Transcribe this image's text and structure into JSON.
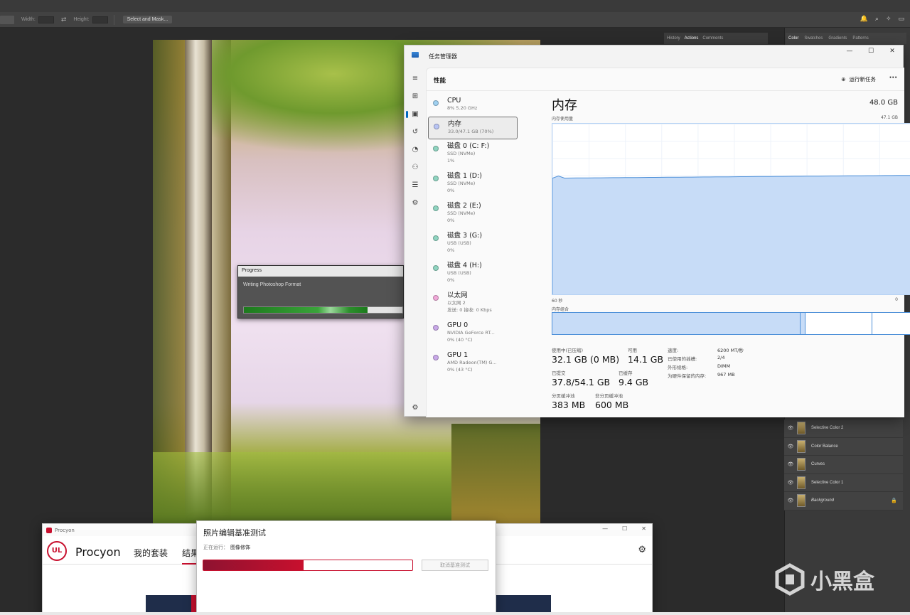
{
  "photoshop": {
    "options_bar": {
      "width_label": "Width:",
      "height_label": "Height:",
      "swap_icon": "swap-icon",
      "select_mask_label": "Select and Mask..."
    },
    "mini_tabs": [
      "History",
      "Actions",
      "Comments"
    ],
    "color_tabs": [
      "Color",
      "Swatches",
      "Gradients",
      "Patterns"
    ],
    "layers": [
      {
        "name": "Selective Color 2"
      },
      {
        "name": "Color Balance"
      },
      {
        "name": "Curves"
      },
      {
        "name": "Selective Color 1"
      },
      {
        "name": "Background"
      }
    ],
    "progress_dialog": {
      "title": "Progress",
      "message": "Writing Photoshop Format",
      "progress_pct": 78
    }
  },
  "task_manager": {
    "title": "任务管理器",
    "window_controls": {
      "minimize": "—",
      "maximize": "☐",
      "close": "✕"
    },
    "section": "性能",
    "run_task": "运行新任务",
    "more": "···",
    "devices": [
      {
        "name": "CPU",
        "sub1": "8% 5.20 GHz",
        "sub2": "",
        "color": "#9fd0f0"
      },
      {
        "name": "内存",
        "sub1": "33.0/47.1 GB (70%)",
        "sub2": "",
        "color": "#b8c4f4"
      },
      {
        "name": "磁盘 0 (C: F:)",
        "sub1": "SSD (NVMe)",
        "sub2": "1%",
        "color": "#8fd4c0"
      },
      {
        "name": "磁盘 1 (D:)",
        "sub1": "SSD (NVMe)",
        "sub2": "0%",
        "color": "#8fd4c0"
      },
      {
        "name": "磁盘 2 (E:)",
        "sub1": "SSD (NVMe)",
        "sub2": "0%",
        "color": "#8fd4c0"
      },
      {
        "name": "磁盘 3 (G:)",
        "sub1": "USB (USB)",
        "sub2": "0%",
        "color": "#8fd4c0"
      },
      {
        "name": "磁盘 4 (H:)",
        "sub1": "USB (USB)",
        "sub2": "0%",
        "color": "#8fd4c0"
      },
      {
        "name": "以太网",
        "sub1": "以太网 2",
        "sub2": "发送: 0 接收: 0 Kbps",
        "color": "#f0a8d8"
      },
      {
        "name": "GPU 0",
        "sub1": "NVIDIA GeForce RT...",
        "sub2": "0% (40 °C)",
        "color": "#c8a8e8"
      },
      {
        "name": "GPU 1",
        "sub1": "AMD Radeon(TM) G...",
        "sub2": "0% (43 °C)",
        "color": "#c8a8e8"
      }
    ],
    "memory": {
      "title": "内存",
      "total": "48.0 GB",
      "usage_label": "内存使用量",
      "usage_max": "47.1 GB",
      "time_left": "60 秒",
      "time_right": "0",
      "composition_label": "内存组合",
      "usage_fraction": 0.7,
      "composition_fractions": [
        0.685,
        0.015,
        0.185,
        0.115
      ],
      "stats": [
        {
          "label": "使用中(已压缩)",
          "value": "32.1 GB (0 MB)"
        },
        {
          "label": "可用",
          "value": "14.1 GB"
        },
        {
          "label": "已提交",
          "value": "37.8/54.1 GB"
        },
        {
          "label": "已缓存",
          "value": "9.4 GB"
        },
        {
          "label": "分页缓冲池",
          "value": "383 MB"
        },
        {
          "label": "非分页缓冲池",
          "value": "600 MB"
        }
      ],
      "details": [
        {
          "k": "速度:",
          "v": "6200 MT/秒"
        },
        {
          "k": "已使用的插槽:",
          "v": "2/4"
        },
        {
          "k": "外形规格:",
          "v": "DIMM"
        },
        {
          "k": "为硬件保留的内存:",
          "v": "967 MB"
        }
      ]
    }
  },
  "procyon": {
    "title": "Procyon",
    "logo": "UL",
    "brand": "Procyon",
    "tabs": [
      "我的套装",
      "结果"
    ],
    "window_controls": {
      "minimize": "—",
      "maximize": "☐",
      "close": "✕"
    },
    "benchmark": {
      "title": "照片编辑基准测试",
      "running_label": "正在运行：",
      "running_value": "图像修饰",
      "progress_pct": 48,
      "cancel_label": "取消基准测试"
    }
  },
  "watermark": {
    "text": "小黑盒"
  }
}
